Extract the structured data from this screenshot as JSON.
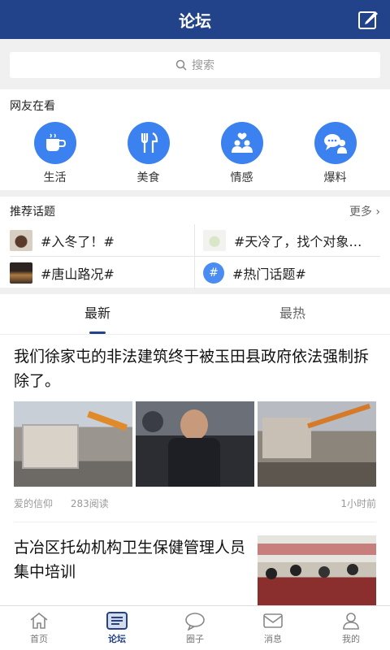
{
  "header": {
    "title": "论坛"
  },
  "search": {
    "placeholder": "搜索"
  },
  "watching": {
    "title": "网友在看",
    "items": [
      {
        "label": "生活",
        "icon": "coffee-cup-icon"
      },
      {
        "label": "美食",
        "icon": "fork-knife-icon"
      },
      {
        "label": "情感",
        "icon": "couple-heart-icon"
      },
      {
        "label": "爆料",
        "icon": "speech-bubble-icon"
      }
    ]
  },
  "topics": {
    "title": "推荐话题",
    "more": "更多 ›",
    "items": [
      {
        "text": "#入冬了！#"
      },
      {
        "text": "#天冷了，找个对象…"
      },
      {
        "text": "#唐山路况#"
      },
      {
        "text": "#热门话题#"
      }
    ]
  },
  "tabs": [
    {
      "label": "最新"
    },
    {
      "label": "最热"
    }
  ],
  "posts": [
    {
      "title": "我们徐家屯的非法建筑终于被玉田县政府依法强制拆除了。",
      "author": "爱的信仰",
      "reads": "283阅读",
      "time": "1小时前"
    },
    {
      "title": "古冶区托幼机构卫生保健管理人员集中培训"
    }
  ],
  "nav": [
    {
      "label": "首页",
      "icon": "home-icon"
    },
    {
      "label": "论坛",
      "icon": "forum-icon"
    },
    {
      "label": "圈子",
      "icon": "chat-bubble-icon"
    },
    {
      "label": "消息",
      "icon": "mail-icon"
    },
    {
      "label": "我的",
      "icon": "user-icon"
    }
  ],
  "colors": {
    "brand": "#22428a",
    "accent": "#3b82f0"
  }
}
